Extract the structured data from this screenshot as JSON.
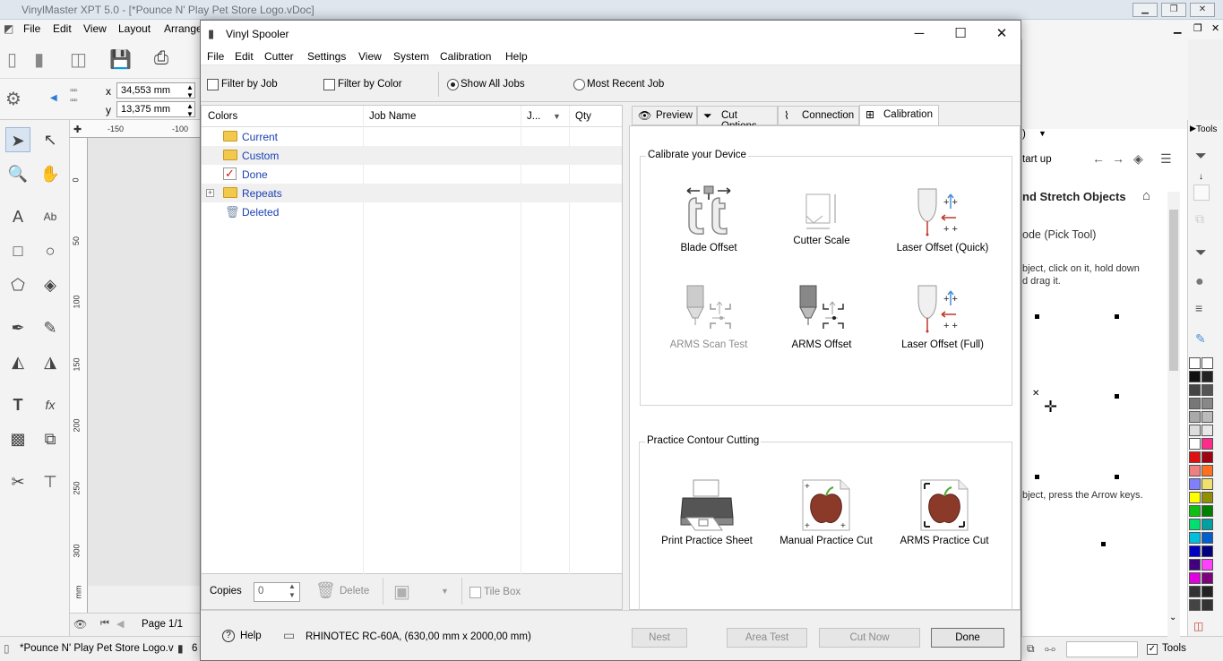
{
  "background_app": {
    "title": "VinylMaster XPT 5.0 - [*Pounce N' Play Pet Store Logo.vDoc]",
    "menu": [
      "File",
      "Edit",
      "View",
      "Layout",
      "Arrange"
    ],
    "coord_x_label": "x",
    "coord_x_value": "34,553 mm",
    "coord_y_label": "y",
    "coord_y_value": "13,375 mm",
    "ruler_h": [
      "-150",
      "-100"
    ],
    "ruler_v": [
      "0",
      "50",
      "100",
      "150",
      "200",
      "250",
      "300",
      "mm"
    ],
    "page_label": "Page 1/1",
    "status_file": "*Pounce N' Play Pet Store Logo.v",
    "status_num": "6",
    "right_panel": {
      "dropdown_tail": ")",
      "start_up": "tart up",
      "heading": "nd Stretch Objects",
      "mode": "ode (Pick Tool)",
      "text1": "bject, click on it, hold down",
      "text2": "d drag it.",
      "text3": "bject, press the Arrow keys."
    },
    "tools_label": "Tools",
    "tools_status_label": "Tools"
  },
  "dialog": {
    "title": "Vinyl Spooler",
    "menu": [
      "File",
      "Edit",
      "Cutter",
      "Settings",
      "View",
      "System",
      "Calibration",
      "Help"
    ],
    "filters": {
      "filter_by_job": "Filter by Job",
      "filter_by_color": "Filter by Color",
      "show_all_jobs": "Show All Jobs",
      "most_recent_job": "Most Recent Job"
    },
    "job_list": {
      "columns": [
        "Colors",
        "Job Name",
        "J...",
        "Qty"
      ],
      "rows": [
        {
          "name": "Current",
          "icon": "folder-icon"
        },
        {
          "name": "Custom",
          "icon": "folder-icon"
        },
        {
          "name": "Done",
          "icon": "checkmark-icon"
        },
        {
          "name": "Repeats",
          "icon": "folder-icon"
        },
        {
          "name": "Deleted",
          "icon": "trash-icon"
        }
      ]
    },
    "jobs_bar": {
      "copies_label": "Copies",
      "copies_value": "0",
      "delete_label": "Delete",
      "tile_box_label": "Tile Box"
    },
    "tabs": [
      "Preview",
      "Cut Options",
      "Connection",
      "Calibration"
    ],
    "calibration": {
      "group1_title": "Calibrate your Device",
      "group1_items": [
        "Blade Offset",
        "Cutter Scale",
        "Laser Offset (Quick)",
        "ARMS Scan Test",
        "ARMS Offset",
        "Laser Offset (Full)"
      ],
      "group2_title": "Practice Contour Cutting",
      "group2_items": [
        "Print Practice Sheet",
        "Manual Practice Cut",
        "ARMS Practice Cut"
      ]
    },
    "bottom": {
      "help": "Help",
      "device": "RHINOTEC RC-60A,  (630,00 mm x 2000,00 mm)",
      "nest": "Nest",
      "area_test": "Area Test",
      "cut_now": "Cut Now",
      "done": "Done"
    }
  },
  "colors": {
    "folder_text": "#1a3fb4",
    "folder_fill": "#f2c94c",
    "done_check": "#d01010"
  }
}
